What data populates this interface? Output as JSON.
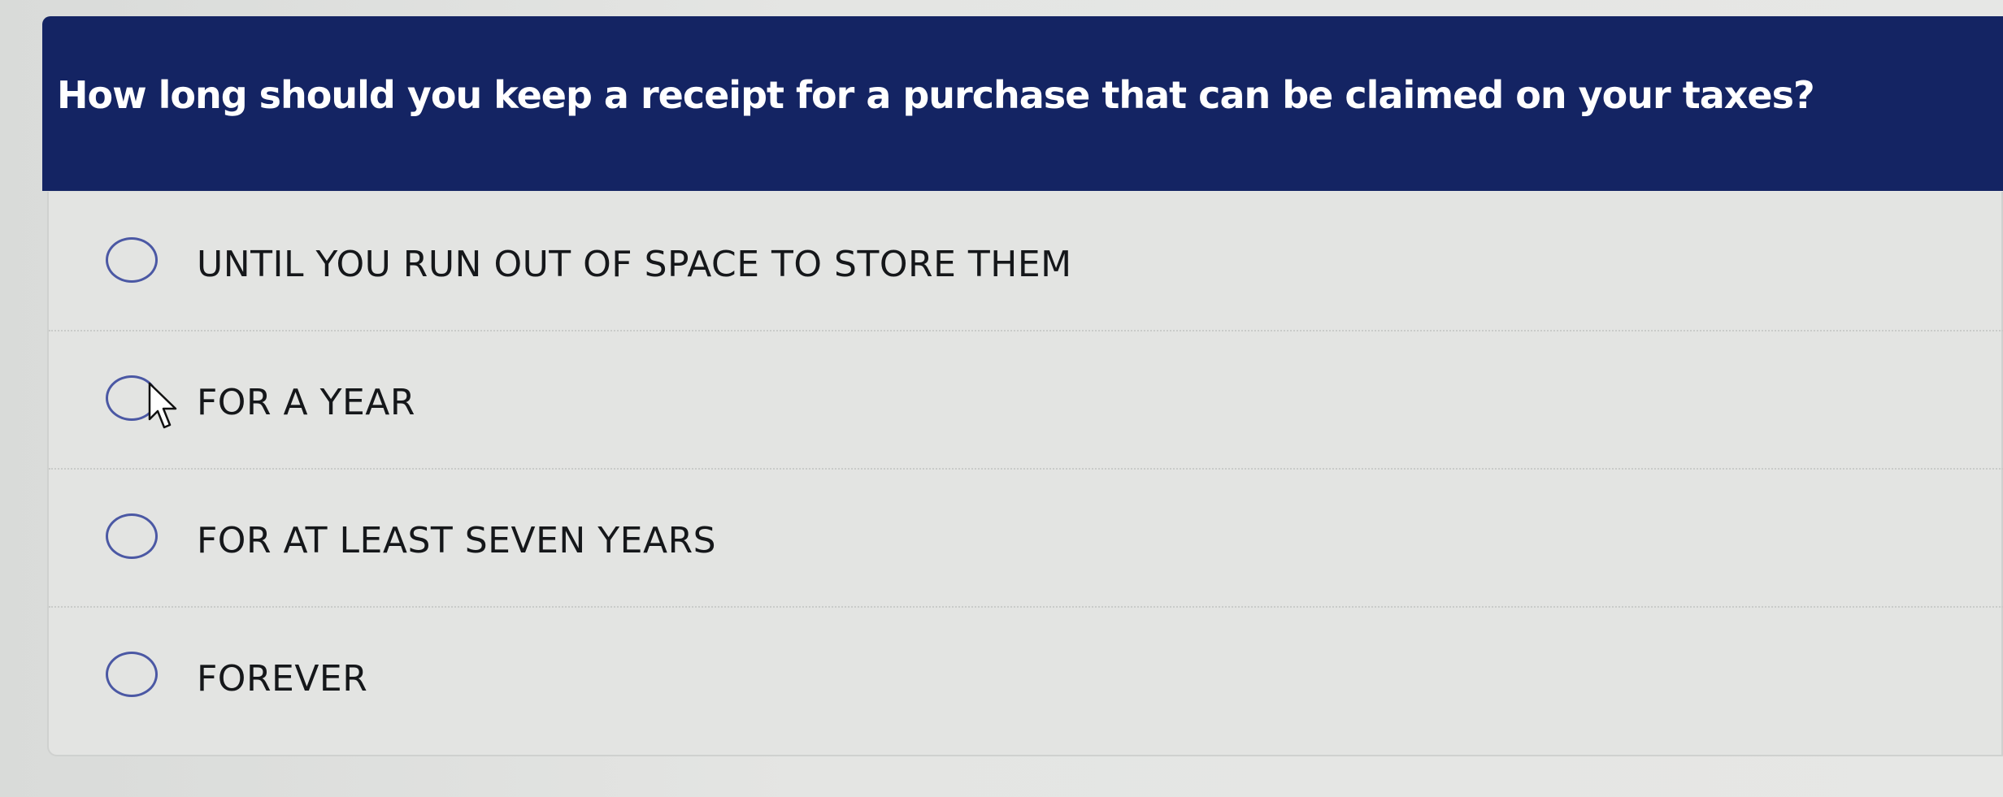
{
  "question": {
    "text": "How long should you keep a receipt for a purchase that can be claimed on your taxes?"
  },
  "options": [
    {
      "label": "UNTIL YOU RUN OUT OF SPACE TO STORE THEM",
      "selected": false
    },
    {
      "label": "FOR A YEAR",
      "selected": false
    },
    {
      "label": "FOR AT LEAST SEVEN YEARS",
      "selected": false
    },
    {
      "label": "FOREVER",
      "selected": false
    }
  ],
  "colors": {
    "header_bg": "#142463",
    "radio_border": "#4b58a4",
    "option_text": "#15171a"
  },
  "cursor": {
    "icon": "arrow-pointer-icon"
  }
}
